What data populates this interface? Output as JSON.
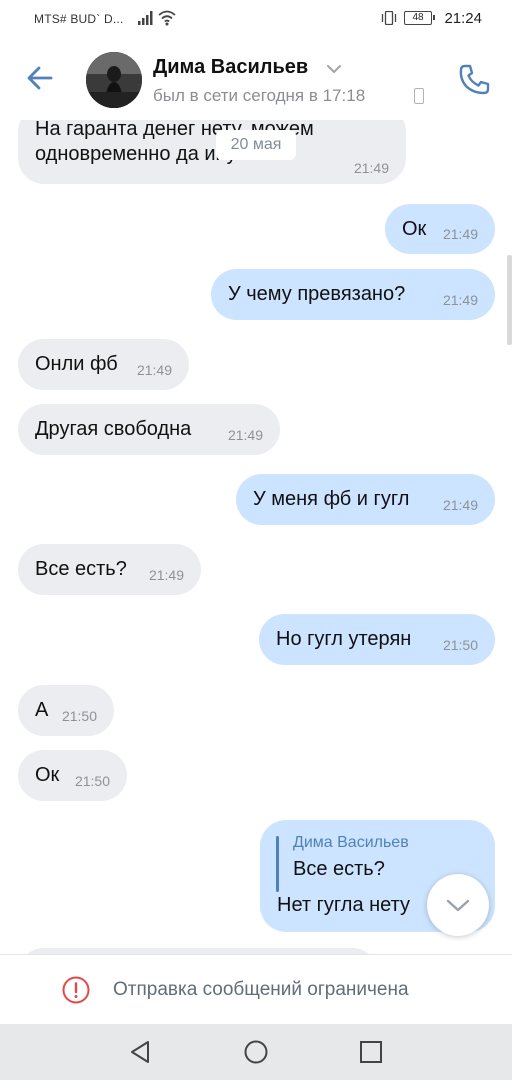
{
  "status_bar": {
    "carrier": "MTS# BUD` D...",
    "battery": "48",
    "time": "21:24"
  },
  "header": {
    "name": "Дима Васильев",
    "last_seen": "был в сети сегодня в 17:18"
  },
  "chat": {
    "date_chip": "20 мая",
    "messages": [
      {
        "dir": "in",
        "text_line1": "На гаранта денег нету, можем",
        "text_line2": "одновременно да        инуть",
        "time": "21:49"
      },
      {
        "dir": "out",
        "text": "Ок",
        "time": "21:49"
      },
      {
        "dir": "out",
        "text": "У чему превязано?",
        "time": "21:49"
      },
      {
        "dir": "in",
        "text": "Онли фб",
        "time": "21:49"
      },
      {
        "dir": "in",
        "text": "Другая свободна",
        "time": "21:49"
      },
      {
        "dir": "out",
        "text": "У меня фб и гугл",
        "time": "21:49"
      },
      {
        "dir": "in",
        "text": "Все есть?",
        "time": "21:49"
      },
      {
        "dir": "out",
        "text": "Но гугл утерян",
        "time": "21:50"
      },
      {
        "dir": "in",
        "text": "А",
        "time": "21:50"
      },
      {
        "dir": "in",
        "text": "Ок",
        "time": "21:50"
      },
      {
        "dir": "out",
        "reply_name": "Дима Васильев",
        "reply_text": "Все есть?",
        "text": "Нет гугла нету"
      }
    ]
  },
  "restriction": {
    "text": "Отправка сообщений ограничена"
  },
  "colors": {
    "accent": "#5181b8",
    "incoming_bubble": "#ecedf0",
    "outgoing_bubble": "#cce4ff",
    "warning": "#e64646"
  },
  "icons": [
    "back-arrow-icon",
    "chevron-down-icon",
    "phone-call-icon",
    "mobile-icon",
    "scroll-down-icon",
    "warning-icon",
    "nav-back-icon",
    "nav-home-icon",
    "nav-recent-icon"
  ]
}
